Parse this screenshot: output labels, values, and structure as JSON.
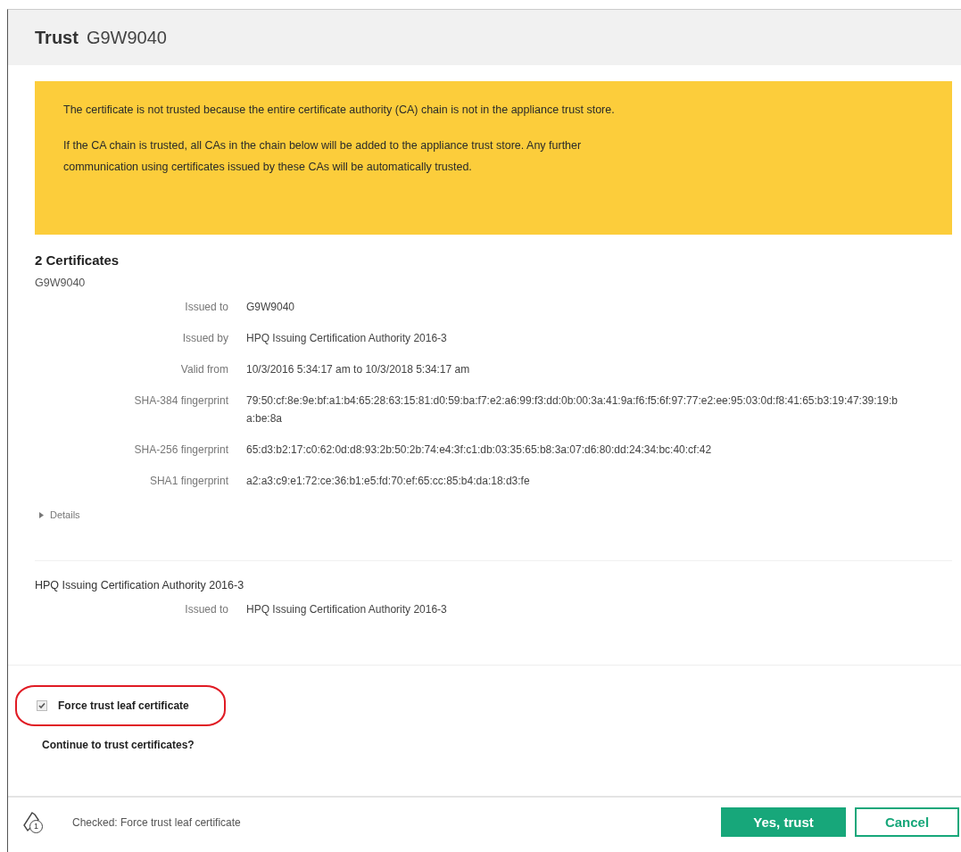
{
  "dialog": {
    "title": "Trust",
    "subtitle": "G9W9040"
  },
  "banner": {
    "paragraphs": [
      "The certificate is not trusted because the entire certificate authority (CA) chain is not in the appliance trust store.",
      "If the CA chain is trusted, all CAs in the chain below will be added to the appliance trust store. Any further communication using certificates issued by these CAs will be automatically trusted."
    ]
  },
  "certificates": {
    "heading": "2 Certificates",
    "items": [
      {
        "name": "G9W9040",
        "fields": [
          {
            "label": "Issued to",
            "value": "G9W9040"
          },
          {
            "label": "Issued by",
            "value": "HPQ Issuing Certification Authority 2016-3"
          },
          {
            "label": "Valid from",
            "value": "10/3/2016 5:34:17 am to 10/3/2018 5:34:17 am"
          },
          {
            "label": "SHA-384 fingerprint",
            "value": "79:50:cf:8e:9e:bf:a1:b4:65:28:63:15:81:d0:59:ba:f7:e2:a6:99:f3:dd:0b:00:3a:41:9a:f6:f5:6f:97:77:e2:ee:95:03:0d:f8:41:65:b3:19:47:39:19:ba:be:8a"
          },
          {
            "label": "SHA-256 fingerprint",
            "value": "65:d3:b2:17:c0:62:0d:d8:93:2b:50:2b:74:e4:3f:c1:db:03:35:65:b8:3a:07:d6:80:dd:24:34:bc:40:cf:42"
          },
          {
            "label": "SHA1 fingerprint",
            "value": "a2:a3:c9:e1:72:ce:36:b1:e5:fd:70:ef:65:cc:85:b4:da:18:d3:fe"
          }
        ],
        "details": {
          "label": "Details",
          "expanded": false
        }
      },
      {
        "name": "HPQ Issuing Certification Authority 2016-3",
        "fields": [
          {
            "label": "Issued to",
            "value": "HPQ Issuing Certification Authority 2016-3"
          }
        ]
      }
    ]
  },
  "options": [
    {
      "label": "Force trust leaf certificate",
      "checked": true,
      "highlighted": true
    }
  ],
  "question": "Continue to trust certificates?",
  "footer": {
    "notification_count": "1",
    "status": "Checked: Force trust leaf certificate",
    "buttons": [
      {
        "label": "Yes, trust",
        "kind": "primary"
      },
      {
        "label": "Cancel",
        "kind": "secondary"
      }
    ]
  }
}
